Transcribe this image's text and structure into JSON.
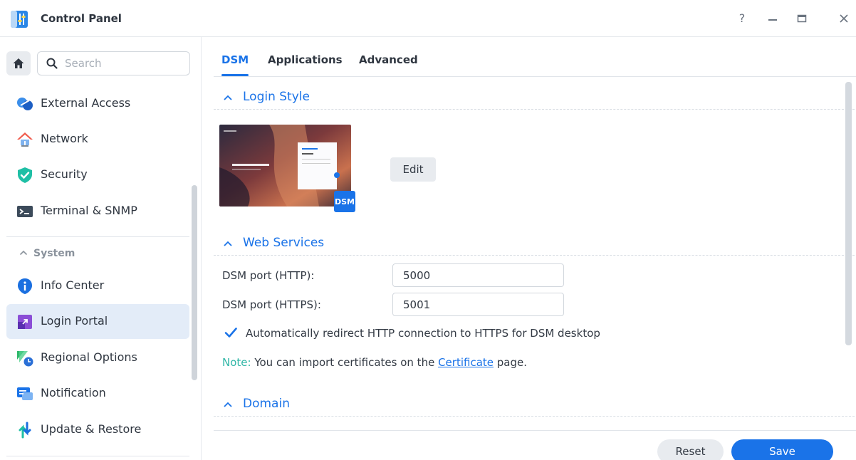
{
  "window": {
    "title": "Control Panel",
    "controls": {
      "help": "?",
      "minimize": "—",
      "maximize": "▭",
      "close": "✕"
    }
  },
  "sidebar": {
    "search_placeholder": "Search",
    "items_top": [
      {
        "label": "External Access",
        "icon": "external-access-icon"
      },
      {
        "label": "Network",
        "icon": "network-house-icon"
      },
      {
        "label": "Security",
        "icon": "shield-icon"
      },
      {
        "label": "Terminal & SNMP",
        "icon": "terminal-icon"
      }
    ],
    "group_label": "System",
    "items_system": [
      {
        "label": "Info Center",
        "icon": "info-icon"
      },
      {
        "label": "Login Portal",
        "icon": "login-portal-icon",
        "active": true
      },
      {
        "label": "Regional Options",
        "icon": "regional-options-icon"
      },
      {
        "label": "Notification",
        "icon": "notification-icon"
      },
      {
        "label": "Update & Restore",
        "icon": "update-restore-icon"
      }
    ]
  },
  "tabs": [
    {
      "label": "DSM",
      "active": true
    },
    {
      "label": "Applications"
    },
    {
      "label": "Advanced"
    }
  ],
  "sections": {
    "login_style": {
      "title": "Login Style",
      "edit_label": "Edit",
      "badge": "DSM"
    },
    "web_services": {
      "title": "Web Services",
      "http_label": "DSM port (HTTP):",
      "http_value": "5000",
      "https_label": "DSM port (HTTPS):",
      "https_value": "5001",
      "redirect_label": "Automatically redirect HTTP connection to HTTPS for DSM desktop",
      "redirect_checked": true,
      "note_key": "Note:",
      "note_pre": " You can import certificates on the ",
      "note_link": "Certificate",
      "note_post": " page."
    },
    "domain": {
      "title": "Domain"
    }
  },
  "footer": {
    "reset_label": "Reset",
    "save_label": "Save"
  },
  "colors": {
    "accent": "#1a73e8",
    "note": "#2fb6a6",
    "active_bg": "#e3ecf8"
  }
}
